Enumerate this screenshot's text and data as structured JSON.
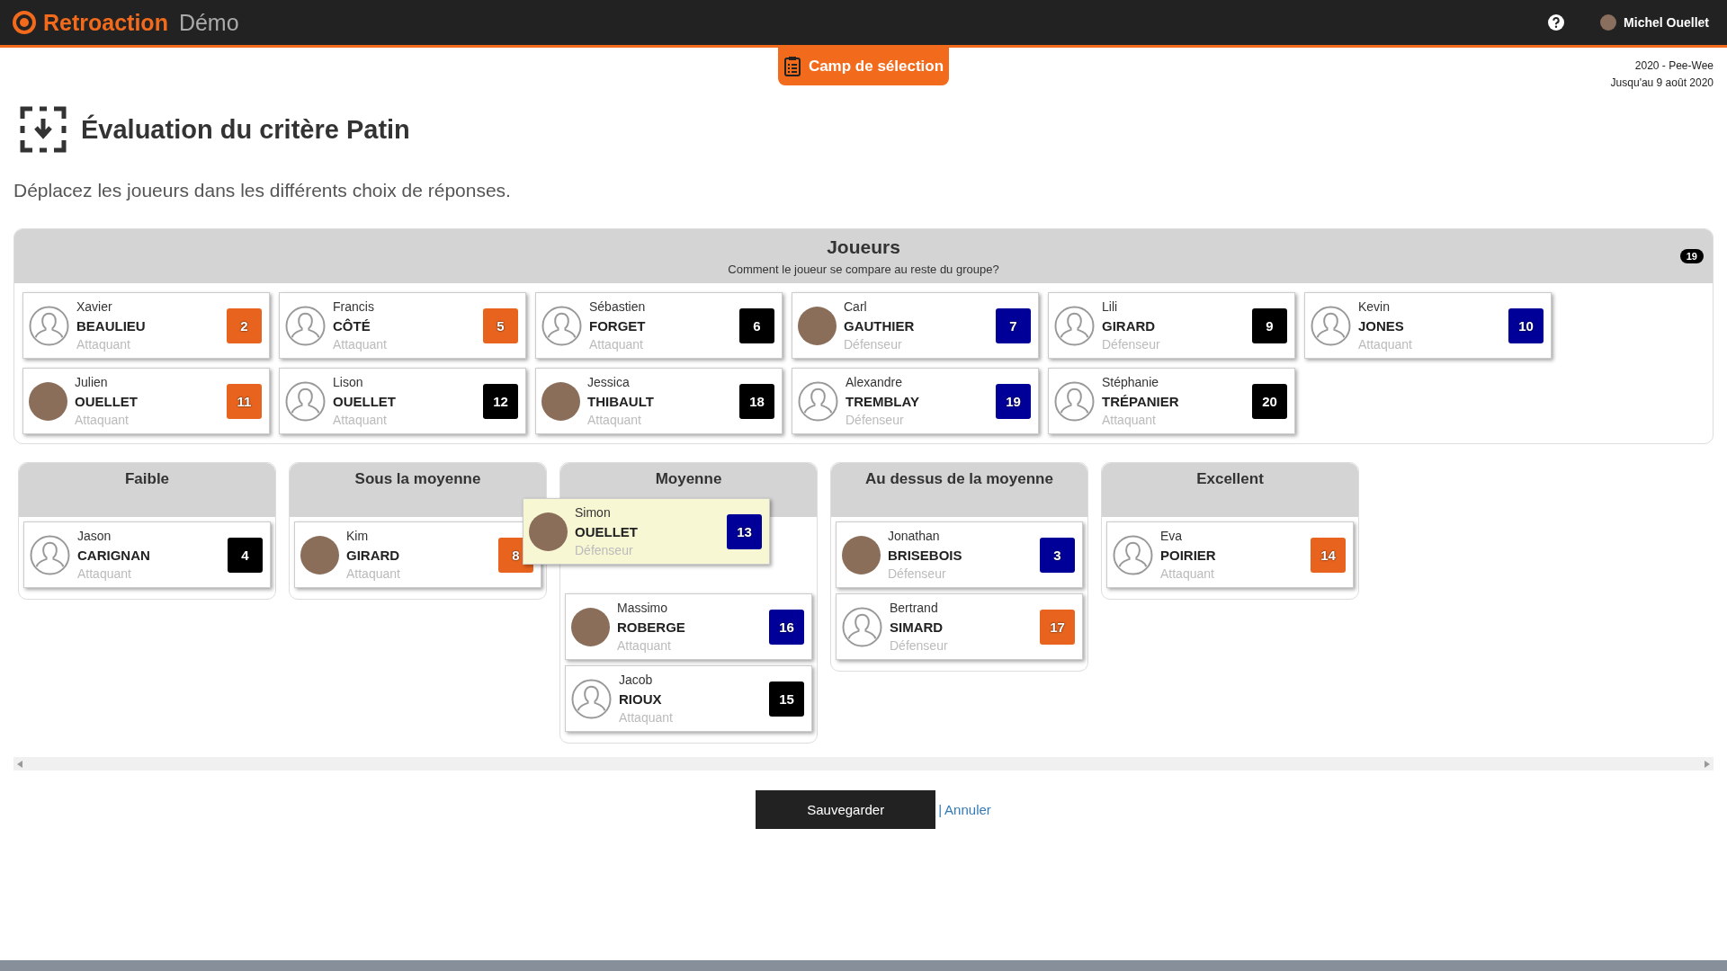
{
  "header": {
    "brand": "Retroaction",
    "edition": "Démo",
    "user": "Michel Ouellet"
  },
  "context_tab": {
    "label": "Camp de sélection"
  },
  "season": {
    "line_1": "2020 - Pee-Wee",
    "line_2": "Jusqu'au 9 août 2020"
  },
  "page": {
    "title": "Évaluation du critère Patin",
    "instructions": "Déplacez les joueurs dans les différents choix de réponses."
  },
  "players_pool": {
    "title": "Joueurs",
    "question": "Comment le joueur se compare au reste du groupe?",
    "count": "19",
    "players": [
      {
        "first": "Xavier",
        "last": "BEAULIEU",
        "position": "Attaquant",
        "number": "2",
        "color": "#e8641e",
        "kind": "silhouette",
        "dragging": false
      },
      {
        "first": "Francis",
        "last": "CÔTÉ",
        "position": "Attaquant",
        "number": "5",
        "color": "#e8641e",
        "kind": "silhouette",
        "dragging": false
      },
      {
        "first": "Sébastien",
        "last": "FORGET",
        "position": "Attaquant",
        "number": "6",
        "color": "#000000",
        "kind": "silhouette",
        "dragging": false
      },
      {
        "first": "Carl",
        "last": "GAUTHIER",
        "position": "Défenseur",
        "number": "7",
        "color": "#000099",
        "kind": "photo",
        "dragging": false
      },
      {
        "first": "Lili",
        "last": "GIRARD",
        "position": "Défenseur",
        "number": "9",
        "color": "#000000",
        "kind": "silhouette",
        "dragging": false
      },
      {
        "first": "Kevin",
        "last": "JONES",
        "position": "Attaquant",
        "number": "10",
        "color": "#000099",
        "kind": "silhouette",
        "dragging": false
      },
      {
        "first": "Julien",
        "last": "OUELLET",
        "position": "Attaquant",
        "number": "11",
        "color": "#e8641e",
        "kind": "photo",
        "dragging": false
      },
      {
        "first": "Lison",
        "last": "OUELLET",
        "position": "Attaquant",
        "number": "12",
        "color": "#000000",
        "kind": "silhouette",
        "dragging": false
      },
      {
        "first": "Jessica",
        "last": "THIBAULT",
        "position": "Attaquant",
        "number": "18",
        "color": "#000000",
        "kind": "photo",
        "dragging": false
      },
      {
        "first": "Alexandre",
        "last": "TREMBLAY",
        "position": "Défenseur",
        "number": "19",
        "color": "#000099",
        "kind": "silhouette",
        "dragging": false
      },
      {
        "first": "Stéphanie",
        "last": "TRÉPANIER",
        "position": "Attaquant",
        "number": "20",
        "color": "#000000",
        "kind": "silhouette",
        "dragging": false
      }
    ]
  },
  "ratings": [
    {
      "title": "Faible",
      "players": [
        {
          "first": "Jason",
          "last": "CARIGNAN",
          "position": "Attaquant",
          "number": "4",
          "color": "#000000",
          "kind": "silhouette",
          "dragging": false
        }
      ]
    },
    {
      "title": "Sous la moyenne",
      "players": [
        {
          "first": "Kim",
          "last": "GIRARD",
          "position": "Attaquant",
          "number": "8",
          "color": "#e8641e",
          "kind": "photo",
          "dragging": false
        }
      ]
    },
    {
      "title": "Moyenne",
      "players": [
        {
          "first": "Simon",
          "last": "OUELLET",
          "position": "Défenseur",
          "number": "13",
          "color": "#000099",
          "kind": "photo",
          "dragging": true
        },
        {
          "first": "Massimo",
          "last": "ROBERGE",
          "position": "Attaquant",
          "number": "16",
          "color": "#000099",
          "kind": "photo",
          "dragging": false
        },
        {
          "first": "Jacob",
          "last": "RIOUX",
          "position": "Attaquant",
          "number": "15",
          "color": "#000000",
          "kind": "silhouette",
          "dragging": false
        }
      ]
    },
    {
      "title": "Au dessus de la moyenne",
      "players": [
        {
          "first": "Jonathan",
          "last": "BRISEBOIS",
          "position": "Défenseur",
          "number": "3",
          "color": "#000099",
          "kind": "photo",
          "dragging": false
        },
        {
          "first": "Bertrand",
          "last": "SIMARD",
          "position": "Défenseur",
          "number": "17",
          "color": "#e8641e",
          "kind": "silhouette",
          "dragging": false
        }
      ]
    },
    {
      "title": "Excellent",
      "players": [
        {
          "first": "Eva",
          "last": "POIRIER",
          "position": "Attaquant",
          "number": "14",
          "color": "#e8641e",
          "kind": "silhouette",
          "dragging": false
        }
      ]
    }
  ],
  "actions": {
    "save": "Sauvegarder",
    "separator": "|",
    "cancel": "Annuler"
  }
}
